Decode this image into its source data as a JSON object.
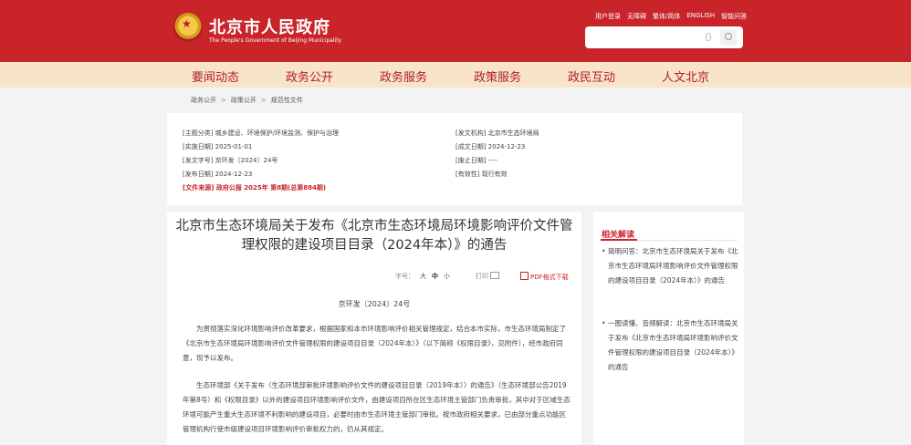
{
  "header": {
    "title": "北京市人民政府",
    "subtitle": "The People's Government of Beijing Municipality",
    "top_links": [
      "用户登录",
      "无障碍",
      "繁体/简体",
      "ENGLISH",
      "智能问答"
    ],
    "search": {
      "placeholder": ""
    }
  },
  "nav": [
    "要闻动态",
    "政务公开",
    "政务服务",
    "政策服务",
    "政民互动",
    "人文北京"
  ],
  "breadcrumb": [
    "政务公开",
    "政策公开",
    "规范性文件"
  ],
  "meta": {
    "topic": "[主题分类] 城乡建设、环境保护/环境监测、保护与治理",
    "effective_date": "[实施日期] 2025-01-01",
    "doc_number": "[发文字号] 京环发〔2024〕24号",
    "publish_date": "[发布日期] 2024-12-23",
    "source": "[文件来源] 政府公报 2025年 第8期(总第884期)",
    "issuer": "[发文机构] 北京市生态环境局",
    "written_date": "[成文日期] 2024-12-23",
    "repeal_date": "[废止日期] ----",
    "validity": "[有效性] 现行有效"
  },
  "article": {
    "title_line1": "北京市生态环境局关于发布《北京市生态环境局环境影响评价文件管",
    "title_line2": "理权限的建设项目目录（2024年本）》的通告",
    "font_label": "字号：",
    "font_sizes": [
      "大",
      "中",
      "小"
    ],
    "print_label": "打印",
    "pdf_label": "PDF格式下载",
    "doc_number": "京环发〔2024〕24号",
    "paragraphs": [
      "为贯彻落实深化环境影响评价改革要求，根据国家和本市环境影响评价相关管理规定，结合本市实际，市生态环境局制定了《北京市生态环境局环境影响评价文件管理权限的建设项目目录（2024年本）》（以下简称《权限目录》，见附件），经市政府同意，现予以发布。",
      "生态环境部《关于发布〈生态环境部审批环境影响评价文件的建设项目目录（2019年本）〉的通告》（生态环境部公告2019年第8号）和《权限目录》以外的建设项目环境影响评价文件，由建设项目所在区生态环境主管部门负责审批，其中对于区域生态环境可能产生重大生态环境不利影响的建设项目，必要时由市生态环境主管部门审批。按市政府相关要求，已由部分重点功能区管理机构行使市级建设项目环境影响评价审批权力的，仍从其规定。"
    ]
  },
  "sidebar": {
    "title": "相关解读",
    "items": [
      "简明问答：北京市生态环境局关于发布《北京市生态环境局环境影响评价文件管理权限的建设项目目录（2024年本）》的通告",
      "一图读懂、音频解读：北京市生态环境局关于发布《北京市生态环境局环境影响评价文件管理权限的建设项目目录（2024年本）》的通告"
    ]
  },
  "colors": {
    "brand_red": "#c9242a",
    "nav_bg": "#f8e4c9"
  },
  "icons": [
    "emblem-icon",
    "mic-icon",
    "search-icon",
    "print-icon",
    "pdf-icon"
  ]
}
